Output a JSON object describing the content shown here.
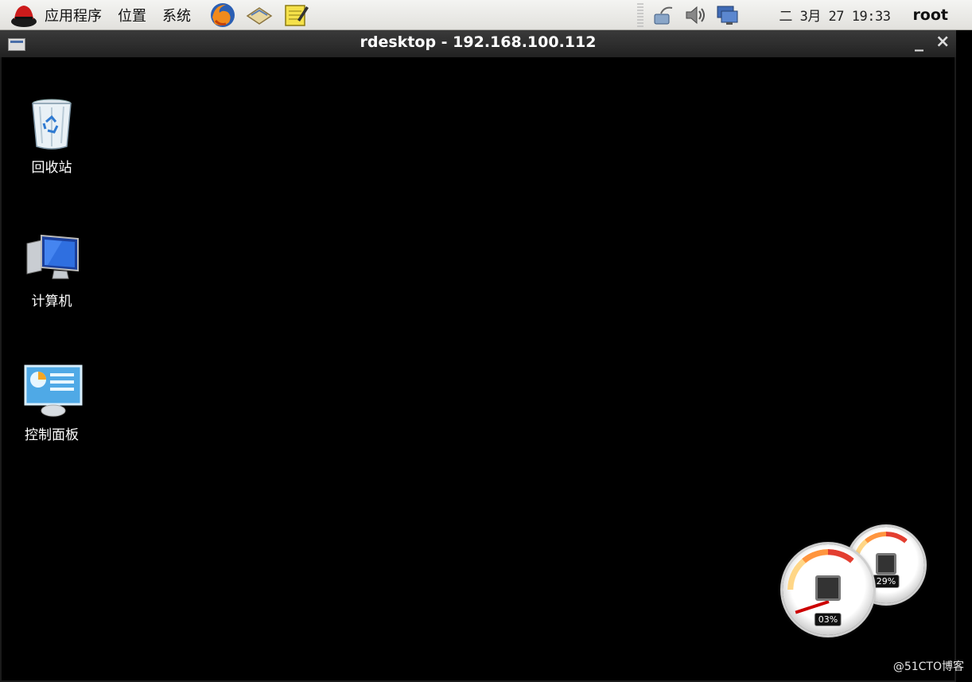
{
  "panel": {
    "menus": [
      "应用程序",
      "位置",
      "系统"
    ],
    "clock": "二 3月 27 19:33",
    "user": "root",
    "launchers": [
      "firefox-icon",
      "mail-icon",
      "notes-icon"
    ],
    "tray": [
      "network-icon",
      "volume-icon",
      "display-icon"
    ]
  },
  "window": {
    "title": "rdesktop - 192.168.100.112",
    "minimize_label": "_",
    "close_label": "×"
  },
  "desktop": {
    "icons": [
      {
        "label": "回收站",
        "icon": "recycle-bin-icon"
      },
      {
        "label": "计算机",
        "icon": "computer-icon"
      },
      {
        "label": "控制面板",
        "icon": "control-panel-icon"
      }
    ]
  },
  "gadgets": {
    "cpu": {
      "readout": "03%",
      "value": 3
    },
    "memory": {
      "readout": "29%",
      "value": 29
    }
  },
  "watermark": "@51CTO博客",
  "colors": {
    "panel": "#e9e8e4",
    "titlebar": "#2a2a2a",
    "desktop": "#000000"
  }
}
